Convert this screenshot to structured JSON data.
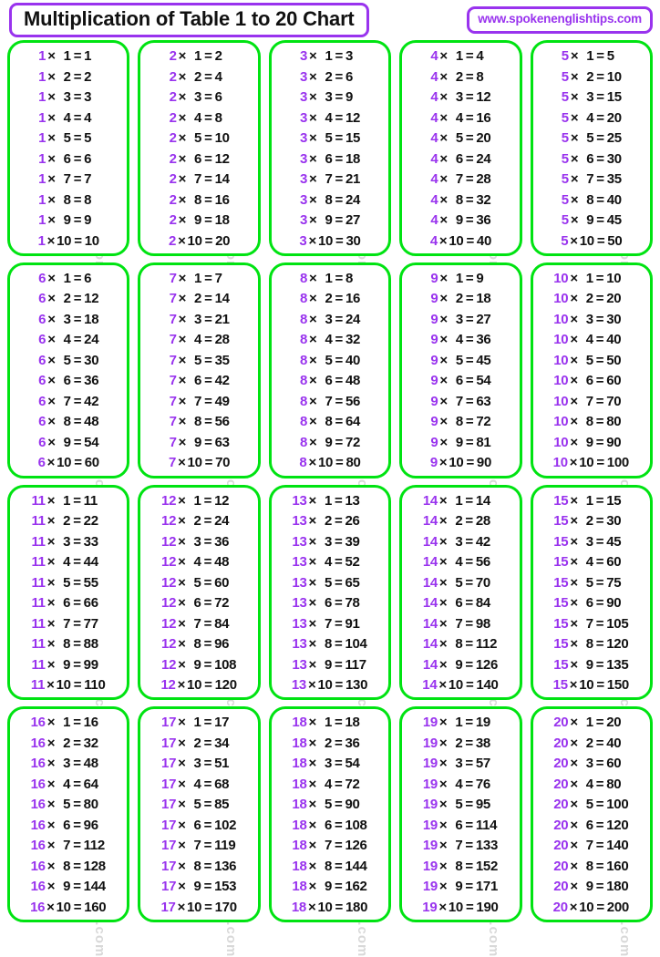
{
  "header": {
    "title": "Multiplication of Table 1 to 20 Chart",
    "site_url": "www.spokenenglishtips.com"
  },
  "watermark": {
    "text": "www.spokenenglishtips.com"
  },
  "colors": {
    "accent_purple": "#9933ee",
    "card_border_green": "#00e312",
    "text_black": "#111111",
    "background": "#ffffff",
    "watermark_gray": "#d8d8d8"
  },
  "symbols": {
    "times": "×",
    "equals": "="
  },
  "chart_data": {
    "type": "table",
    "title": "Multiplication of Table 1 to 20 Chart",
    "description": "Multiplication tables for 1 through 20, each listing products for multipliers 1 to 10.",
    "columns": 5,
    "rows": 4,
    "multipliers": [
      1,
      2,
      3,
      4,
      5,
      6,
      7,
      8,
      9,
      10
    ],
    "tables": [
      {
        "base": 1,
        "products": [
          1,
          2,
          3,
          4,
          5,
          6,
          7,
          8,
          9,
          10
        ]
      },
      {
        "base": 2,
        "products": [
          2,
          4,
          6,
          8,
          10,
          12,
          14,
          16,
          18,
          20
        ]
      },
      {
        "base": 3,
        "products": [
          3,
          6,
          9,
          12,
          15,
          18,
          21,
          24,
          27,
          30
        ]
      },
      {
        "base": 4,
        "products": [
          4,
          8,
          12,
          16,
          20,
          24,
          28,
          32,
          36,
          40
        ]
      },
      {
        "base": 5,
        "products": [
          5,
          10,
          15,
          20,
          25,
          30,
          35,
          40,
          45,
          50
        ]
      },
      {
        "base": 6,
        "products": [
          6,
          12,
          18,
          24,
          30,
          36,
          42,
          48,
          54,
          60
        ]
      },
      {
        "base": 7,
        "products": [
          7,
          14,
          21,
          28,
          35,
          42,
          49,
          56,
          63,
          70
        ]
      },
      {
        "base": 8,
        "products": [
          8,
          16,
          24,
          32,
          40,
          48,
          56,
          64,
          72,
          80
        ]
      },
      {
        "base": 9,
        "products": [
          9,
          18,
          27,
          36,
          45,
          54,
          63,
          72,
          81,
          90
        ]
      },
      {
        "base": 10,
        "products": [
          10,
          20,
          30,
          40,
          50,
          60,
          70,
          80,
          90,
          100
        ]
      },
      {
        "base": 11,
        "products": [
          11,
          22,
          33,
          44,
          55,
          66,
          77,
          88,
          99,
          110
        ]
      },
      {
        "base": 12,
        "products": [
          12,
          24,
          36,
          48,
          60,
          72,
          84,
          96,
          108,
          120
        ]
      },
      {
        "base": 13,
        "products": [
          13,
          26,
          39,
          52,
          65,
          78,
          91,
          104,
          117,
          130
        ]
      },
      {
        "base": 14,
        "products": [
          14,
          28,
          42,
          56,
          70,
          84,
          98,
          112,
          126,
          140
        ]
      },
      {
        "base": 15,
        "products": [
          15,
          30,
          45,
          60,
          75,
          90,
          105,
          120,
          135,
          150
        ]
      },
      {
        "base": 16,
        "products": [
          16,
          32,
          48,
          64,
          80,
          96,
          112,
          128,
          144,
          160
        ]
      },
      {
        "base": 17,
        "products": [
          17,
          34,
          51,
          68,
          85,
          102,
          119,
          136,
          153,
          170
        ]
      },
      {
        "base": 18,
        "products": [
          18,
          36,
          54,
          72,
          90,
          108,
          126,
          144,
          162,
          180
        ]
      },
      {
        "base": 19,
        "products": [
          19,
          38,
          57,
          76,
          95,
          114,
          133,
          152,
          171,
          190
        ]
      },
      {
        "base": 20,
        "products": [
          20,
          40,
          60,
          80,
          100,
          120,
          140,
          160,
          180,
          200
        ]
      }
    ]
  }
}
